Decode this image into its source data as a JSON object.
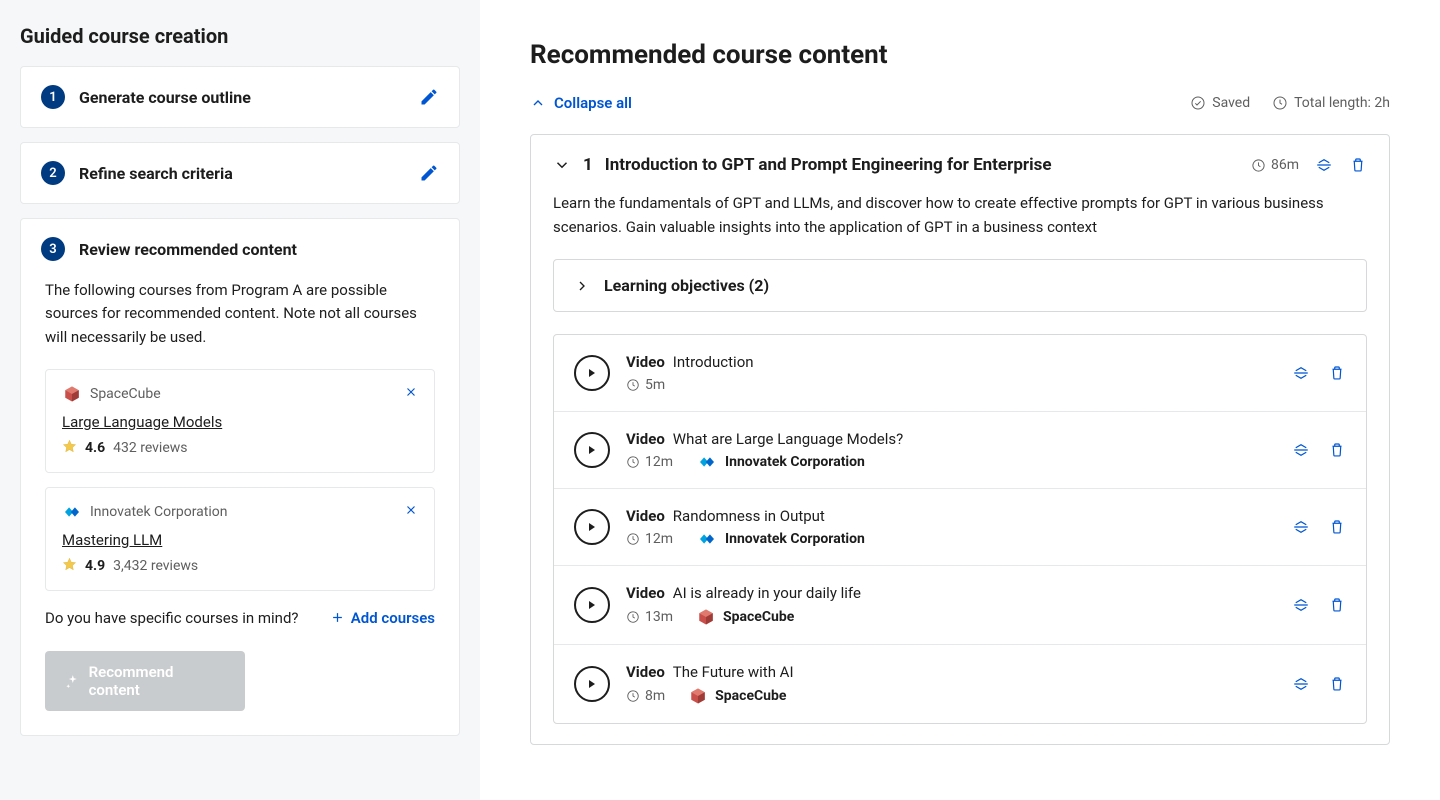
{
  "sidebar": {
    "title": "Guided course creation",
    "steps": [
      {
        "num": "1",
        "title": "Generate course outline"
      },
      {
        "num": "2",
        "title": "Refine search criteria"
      },
      {
        "num": "3",
        "title": "Review recommended content"
      }
    ],
    "review": {
      "desc": "The following courses from Program A are possible sources for recommended content. Note not all courses will necessarily be used.",
      "add_prompt": "Do you have specific courses in mind?",
      "add_label": "Add courses",
      "recommend_label": "Recommend content"
    },
    "courses": [
      {
        "provider": "SpaceCube",
        "title": "Large Language Models",
        "rating": "4.6",
        "reviews": "432 reviews",
        "logo": "spacecube"
      },
      {
        "provider": "Innovatek Corporation",
        "title": "Mastering LLM",
        "rating": "4.9",
        "reviews": "3,432 reviews",
        "logo": "innovatek"
      }
    ]
  },
  "main": {
    "heading": "Recommended course content",
    "collapse_label": "Collapse all",
    "saved_label": "Saved",
    "total_length_label": "Total length: 2h",
    "module": {
      "num": "1",
      "title": "Introduction to GPT and Prompt Engineering for Enterprise",
      "duration": "86m",
      "desc": "Learn the fundamentals of GPT and LLMs, and discover how to create effective prompts for GPT in various business scenarios. Gain valuable insights into the application of GPT in a business context",
      "objectives_label": "Learning objectives (2)"
    },
    "items": [
      {
        "type": "Video",
        "title": "Introduction",
        "duration": "5m",
        "provider": "",
        "logo": ""
      },
      {
        "type": "Video",
        "title": "What are Large Language Models?",
        "duration": "12m",
        "provider": "Innovatek Corporation",
        "logo": "innovatek"
      },
      {
        "type": "Video",
        "title": "Randomness in Output",
        "duration": "12m",
        "provider": "Innovatek Corporation",
        "logo": "innovatek"
      },
      {
        "type": "Video",
        "title": "AI is already in your daily life",
        "duration": "13m",
        "provider": "SpaceCube",
        "logo": "spacecube"
      },
      {
        "type": "Video",
        "title": "The Future with AI",
        "duration": "8m",
        "provider": "SpaceCube",
        "logo": "spacecube"
      }
    ]
  }
}
